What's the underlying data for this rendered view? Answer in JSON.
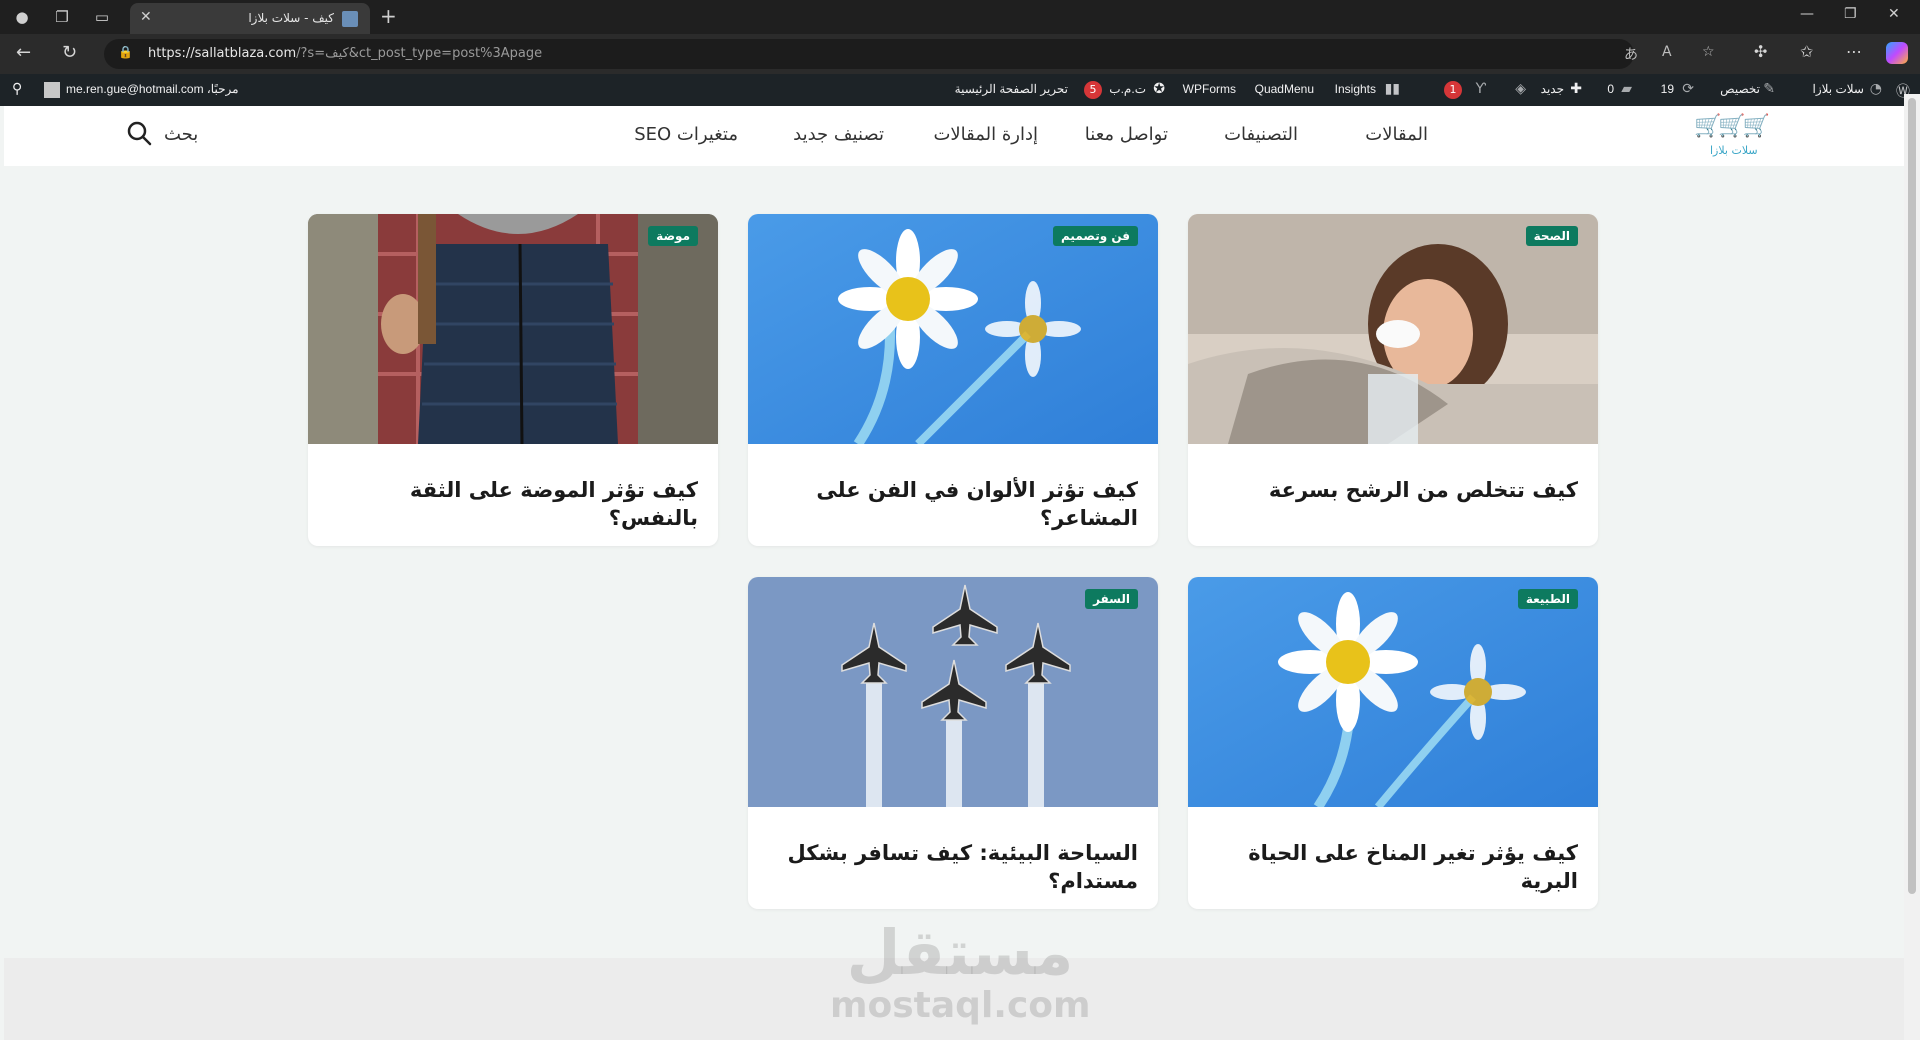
{
  "browser": {
    "tab_title": "كيف - سلات بلازا",
    "url_domain": "https://sallatblaza.com",
    "url_rest": "/?s=كيف&ct_post_type=post%3Apage"
  },
  "adminbar": {
    "site_name": "سلات بلازا",
    "customize": "تخصيص",
    "updates_count": "19",
    "comments_count": "0",
    "new": "جديد",
    "yoast_badge": "1",
    "insights": "Insights",
    "quadmenu": "QuadMenu",
    "wpforms": "WPForms",
    "tmb_label": "ت.م.ب",
    "tmb_badge": "5",
    "edit_home": "تحرير الصفحة الرئيسية",
    "greeting": "مرحبًا، me.ren.gue@hotmail.com"
  },
  "header": {
    "logo_text": "سلات بلازا",
    "menu": [
      "المقالات",
      "التصنيفات",
      "تواصل معنا",
      "إدارة المقالات",
      "تصنيف جديد",
      "متغيرات SEO"
    ],
    "search_label": "بحث"
  },
  "cards": [
    {
      "badge": "الصحة",
      "title": "كيف تتخلص من الرشح بسرعة",
      "image": "sick-woman-photo"
    },
    {
      "badge": "فن وتصميم",
      "title": "كيف تؤثر الألوان في الفن على المشاعر؟",
      "image": "daisy-photo"
    },
    {
      "badge": "موضة",
      "title": "كيف تؤثر الموضة على الثقة بالنفس؟",
      "image": "vest-fashion-photo"
    },
    {
      "badge": "الطبيعة",
      "title": "كيف يؤثر تغير المناخ على الحياة البرية",
      "image": "daisy-photo"
    },
    {
      "badge": "السفر",
      "title": "السياحة البيئية: كيف تسافر بشكل مستدام؟",
      "image": "jets-photo"
    }
  ],
  "watermark": {
    "arabic": "مستقل",
    "latin": "mostaql.com"
  },
  "colors": {
    "badge": "#0d7a5f",
    "adminbar": "#1d2327",
    "logo": "#3aa6c7"
  }
}
